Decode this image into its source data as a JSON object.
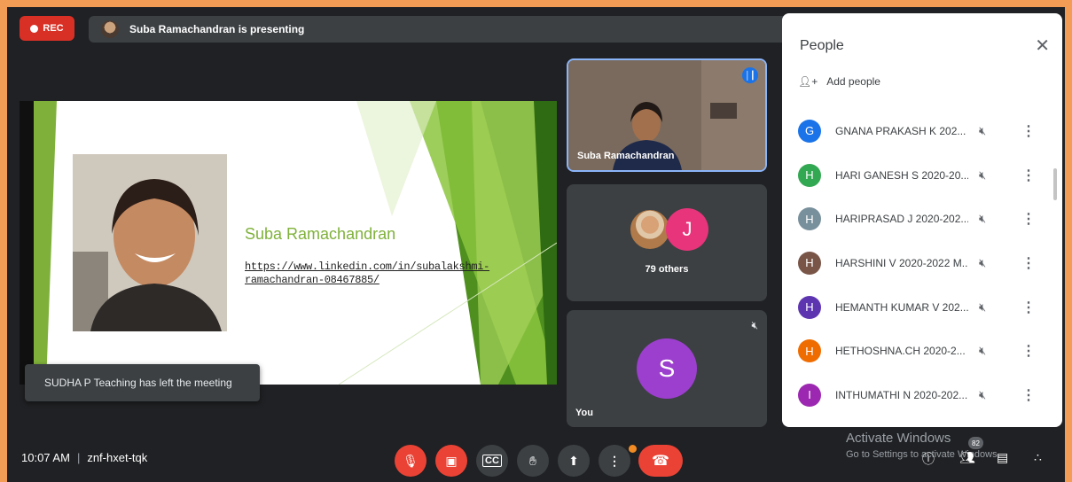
{
  "top": {
    "rec_label": "REC",
    "presenting_text": "Suba Ramachandran is presenting"
  },
  "slide": {
    "name": "Suba Ramachandran",
    "link_line1": "https://www.linkedin.com/in/subalakshmi-",
    "link_line2": "ramachandran-08467885/"
  },
  "toast": "SUDHA P Teaching has left the meeting",
  "tiles": {
    "main_name": "Suba Ramachandran",
    "others_initial": "J",
    "others_label": "79 others",
    "you_initial": "S",
    "you_label": "You"
  },
  "people": {
    "title": "People",
    "add_label": "Add people",
    "list": [
      {
        "initial": "G",
        "name": "GNANA PRAKASH K 202...",
        "color": "#1a73e8"
      },
      {
        "initial": "H",
        "name": "HARI GANESH S 2020-20...",
        "color": "#33a852"
      },
      {
        "initial": "H",
        "name": "HARIPRASAD J 2020-202...",
        "color": "#78909c"
      },
      {
        "initial": "H",
        "name": "HARSHINI V 2020-2022 M...",
        "color": "#795548"
      },
      {
        "initial": "H",
        "name": "HEMANTH KUMAR V 202...",
        "color": "#5e35b1"
      },
      {
        "initial": "H",
        "name": "HETHOSHNA.CH 2020-2...",
        "color": "#ef6c00"
      },
      {
        "initial": "I",
        "name": "INTHUMATHI N 2020-202...",
        "color": "#9c27b0"
      }
    ]
  },
  "bottom": {
    "time": "10:07 AM",
    "meeting_code": "znf-hxet-tqk",
    "participant_count": "82",
    "activate_title": "Activate Windows",
    "activate_sub": "Go to Settings to activate Windows."
  },
  "colors": {
    "accent": "#8ab4f8",
    "danger": "#ea4335",
    "slide_green": "#7fb13a"
  }
}
